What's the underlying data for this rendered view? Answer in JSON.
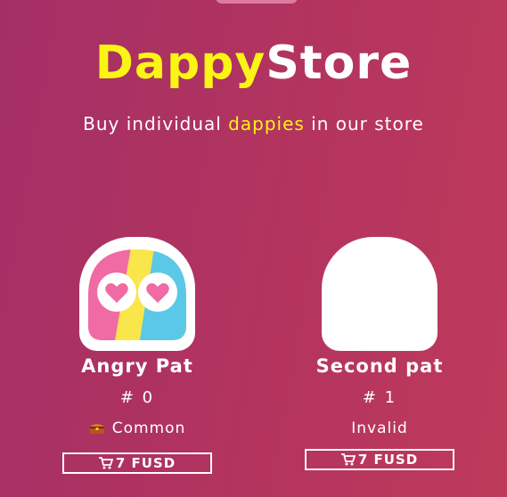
{
  "header": {
    "title_accent": "Dappy",
    "title_rest": "Store",
    "subtitle_before": "Buy individual ",
    "subtitle_highlight": "dappies",
    "subtitle_after": " in our store"
  },
  "colors": {
    "accent": "#fbf514",
    "background_start": "#a42f67",
    "background_end": "#bf3a5b"
  },
  "cards": [
    {
      "name": "Angry Pat",
      "number": "# 0",
      "rarity": "Common",
      "rarity_icon": "chest-icon",
      "buy_label": "7 FUSD",
      "buy_icon": "cart-icon",
      "avatar_icon": "dappy-heart-eyes-icon"
    },
    {
      "name": "Second pat",
      "number": "# 1",
      "rarity": "Invalid",
      "buy_label": "7 FUSD",
      "buy_icon": "cart-icon",
      "avatar_icon": "dappy-blank-icon"
    }
  ]
}
